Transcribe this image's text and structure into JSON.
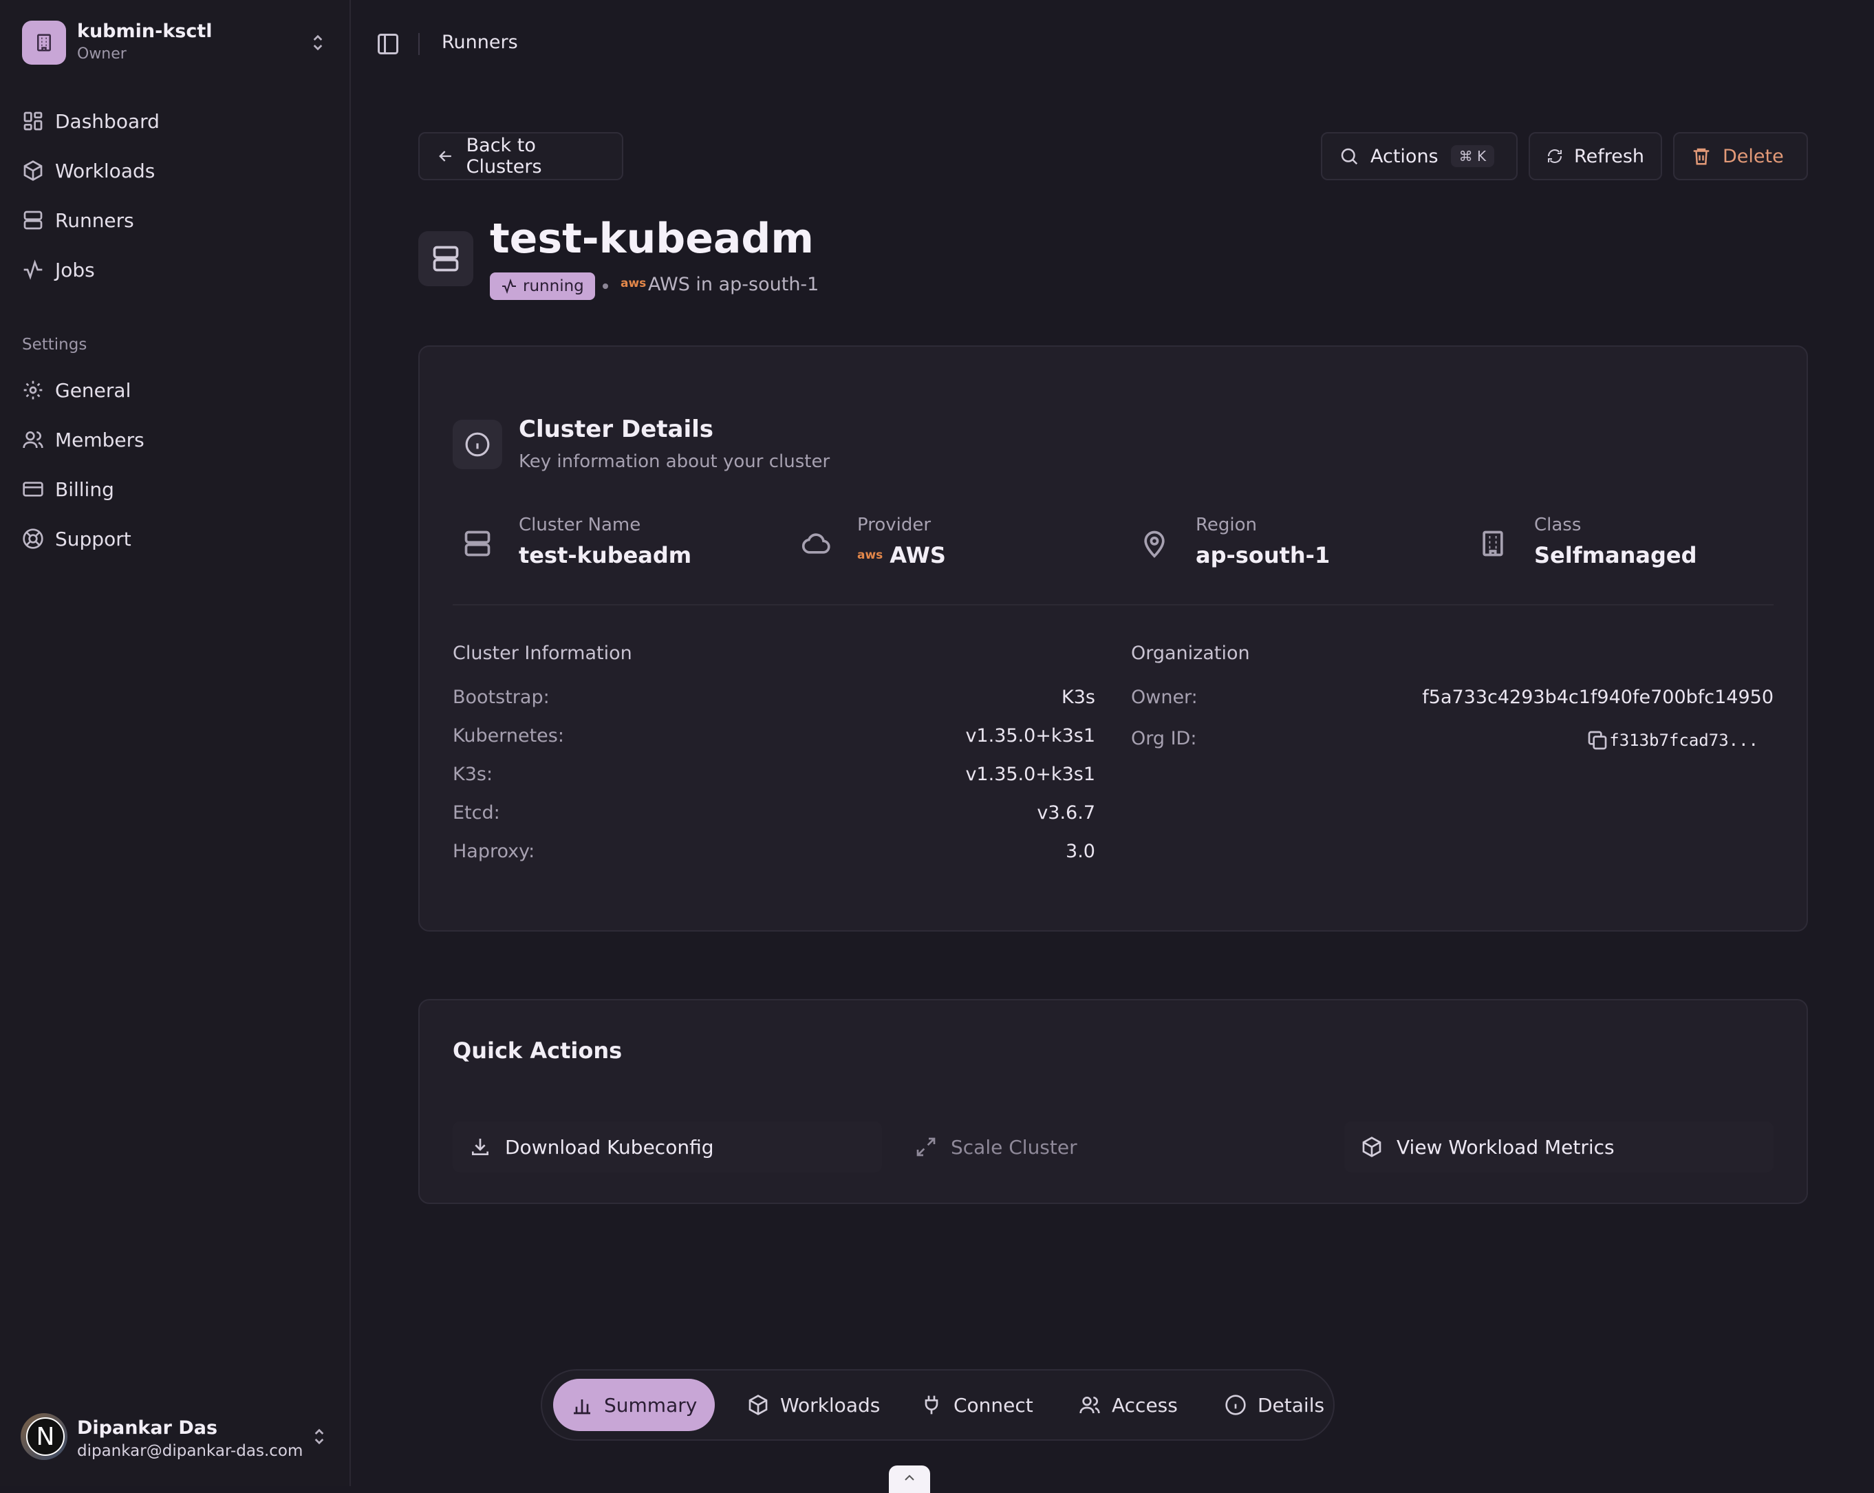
{
  "sidebar": {
    "org": {
      "name": "kubmin-ksctl",
      "role": "Owner"
    },
    "nav": [
      {
        "label": "Dashboard",
        "icon": "dashboard-icon"
      },
      {
        "label": "Workloads",
        "icon": "box-icon"
      },
      {
        "label": "Runners",
        "icon": "server-icon"
      },
      {
        "label": "Jobs",
        "icon": "activity-icon"
      }
    ],
    "settings_heading": "Settings",
    "settings": [
      {
        "label": "General",
        "icon": "gear-icon"
      },
      {
        "label": "Members",
        "icon": "users-icon"
      },
      {
        "label": "Billing",
        "icon": "credit-card-icon"
      },
      {
        "label": "Support",
        "icon": "lifebuoy-icon"
      }
    ],
    "user": {
      "initial": "N",
      "name": "Dipankar Das",
      "email": "dipankar@dipankar-das.com"
    }
  },
  "topbar": {
    "breadcrumb": "Runners"
  },
  "toolbar": {
    "back_label": "Back to Clusters",
    "actions_label": "Actions",
    "actions_shortcut": "⌘ K",
    "refresh_label": "Refresh",
    "delete_label": "Delete"
  },
  "cluster": {
    "name": "test-kubeadm",
    "status": "running",
    "provider_logo": "aws",
    "provider_line": "AWS in ap-south-1"
  },
  "details": {
    "title": "Cluster Details",
    "subtitle": "Key information about your cluster",
    "stats": [
      {
        "label": "Cluster Name",
        "value": "test-kubeadm",
        "icon": "server-icon"
      },
      {
        "label": "Provider",
        "value": "AWS",
        "logo": "aws",
        "icon": "cloud-icon"
      },
      {
        "label": "Region",
        "value": "ap-south-1",
        "icon": "map-pin-icon"
      },
      {
        "label": "Class",
        "value": "Selfmanaged",
        "icon": "building-icon"
      }
    ],
    "info_title": "Cluster Information",
    "info": [
      {
        "label": "Bootstrap:",
        "value": "K3s"
      },
      {
        "label": "Kubernetes:",
        "value": "v1.35.0+k3s1"
      },
      {
        "label": "K3s:",
        "value": "v1.35.0+k3s1"
      },
      {
        "label": "Etcd:",
        "value": "v3.6.7"
      },
      {
        "label": "Haproxy:",
        "value": "3.0"
      }
    ],
    "org_title": "Organization",
    "owner_label": "Owner:",
    "owner_value": "f5a733c4293b4c1f940fe700bfc14950",
    "org_id_label": "Org ID:",
    "org_id_value": "f313b7fcad73..."
  },
  "quick_actions": {
    "title": "Quick Actions",
    "download": "Download Kubeconfig",
    "scale": "Scale Cluster",
    "metrics": "View Workload Metrics"
  },
  "tabs": [
    {
      "label": "Summary",
      "icon": "bar-chart-icon",
      "active": true
    },
    {
      "label": "Workloads",
      "icon": "box-icon"
    },
    {
      "label": "Connect",
      "icon": "plug-icon"
    },
    {
      "label": "Access",
      "icon": "users-icon"
    },
    {
      "label": "Details",
      "icon": "info-icon"
    }
  ],
  "colors": {
    "accent": "#c8a6d6",
    "background": "#1b1922",
    "card": "#221f29",
    "danger": "#e39a78",
    "aws": "#e3874a"
  }
}
